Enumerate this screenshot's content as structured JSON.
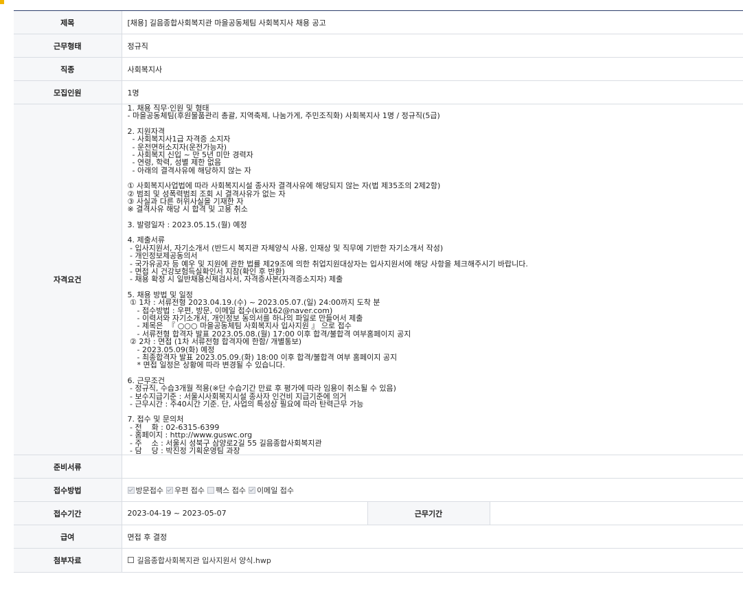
{
  "rows": {
    "title": {
      "label": "제목",
      "value": "[채용] 길음종합사회복지관 마을공동체팀 사회복지사 채용 공고"
    },
    "work_type": {
      "label": "근무형태",
      "value": "정규직"
    },
    "job_type": {
      "label": "직종",
      "value": "사회복지사"
    },
    "headcount": {
      "label": "모집인원",
      "value": "1명"
    },
    "requirements": {
      "label": "자격요건",
      "lines": [
        "1. 채용 직무·인원 및 형태",
        "- 마을공동체팀(후원물품관리 총괄, 지역축제, 나눔가게, 주민조직화) 사회복지사 1명 / 정규직(5급)",
        "",
        "2. 지원자격",
        "  - 사회복지사1급 자격증 소지자",
        "  - 운전면허소지자(운전가능자)",
        "  - 사회복지 신입 ~ 만 5년 미만 경력자",
        "  - 연령, 학력, 성별 제한 없음",
        "  - 아래의 결격사유에 해당하지 않는 자",
        "",
        "① 사회복지사업법에 따라 사회복지시설 종사자 결격사유에 해당되지 않는 자(법 제35조의 2제2항)",
        "② 범죄 및 성폭력범죄 조회 시 결격사유가 없는 자",
        "③ 사실과 다른 허위사실을 기재한 자",
        "※ 결격사유 해당 시 합격 및 고용 취소",
        "",
        "3. 발령일자 : 2023.05.15.(월) 예정",
        "",
        "4. 제출서류",
        " - 입사지원서, 자기소개서 (반드시 복지관 자체양식 사용, 인재상 및 직무에 기반한 자기소개서 작성)",
        " - 개인정보제공동의서",
        " - 국가유공자 등 예우 및 지원에 관한 법률 제29조에 의한 취업지원대상자는 입사지원서에 해당 사항을 체크해주시기 바랍니다.",
        " - 면접 시 건강보험득실확인서 지참(확인 후 반환)",
        " - 채용 확정 시 일반채용신체검사서, 자격증사본(자격증소지자) 제출",
        "",
        "5. 채용 방법 및 일정",
        " ① 1차 : 서류전형 2023.04.19.(수) ~ 2023.05.07.(일) 24:00까지 도착 분",
        "    - 접수방법 : 우편, 방문, 이메일 접수(kil0162@naver.com)",
        "    - 이력서와 자기소개서, 개인정보 동의서를 하나의 파일로 만들어서 제출",
        "    - 제목은  『 ○○○ 마을공동체팀 사회복지사 입사지원 』 으로 접수",
        "    - 서류전형 합격자 발표 2023.05.08.(월) 17:00 이후 합격/불합격 여부홈페이지 공지",
        " ② 2차 : 면접 (1차 서류전형 합격자에 한함/ 개별통보)",
        "    - 2023.05.09(화) 예정",
        "    - 최종합격자 발표 2023.05.09.(화) 18:00 이후 합격/불합격 여부 홈페이지 공지",
        "    * 면접 일정은 상황에 따라 변경될 수 있습니다.",
        "",
        "6. 근무조건",
        " - 정규직, 수습3개월 적용(※단 수습기간 만료 후 평가에 따라 임용이 취소될 수 있음)",
        " - 보수지급기준 : 서울시사회복지시설 종사자 인건비 지급기준에 의거",
        " - 근무시간 : 주40시간 기준. 단, 사업의 특성상 필요에 따라 탄력근무 가능",
        "",
        "7. 접수 및 문의처",
        " - 전    화 : 02-6315-6399",
        " - 홈페이지 : http://www.guswc.org",
        " - 주    소 : 서울시 성북구 삼양로2길 55 길음종합사회복지관",
        " - 담    당 : 박진정 기획운영팀 과장"
      ]
    },
    "documents": {
      "label": "준비서류",
      "value": ""
    },
    "apply_method": {
      "label": "접수방법",
      "options": [
        {
          "label": "방문접수",
          "checked": true
        },
        {
          "label": "우편 접수",
          "checked": true
        },
        {
          "label": "팩스 접수",
          "checked": false
        },
        {
          "label": "이메일 접수",
          "checked": true
        }
      ]
    },
    "period": {
      "label": "접수기간",
      "value": "2023-04-19 ~ 2023-05-07",
      "label2": "근무기간",
      "value2": ""
    },
    "salary": {
      "label": "급여",
      "value": "면접 후 결정"
    },
    "attachment": {
      "label": "첨부자료",
      "value": "길음종합사회복지관 입사지원서 양식.hwp"
    }
  },
  "icons": {
    "corner": "orange-square",
    "file": "file-icon"
  },
  "colors": {
    "header_bg": "#f6f7f9",
    "border": "#d9dde3",
    "top_line": "#2b3d6b",
    "accent": "#f0b400"
  }
}
